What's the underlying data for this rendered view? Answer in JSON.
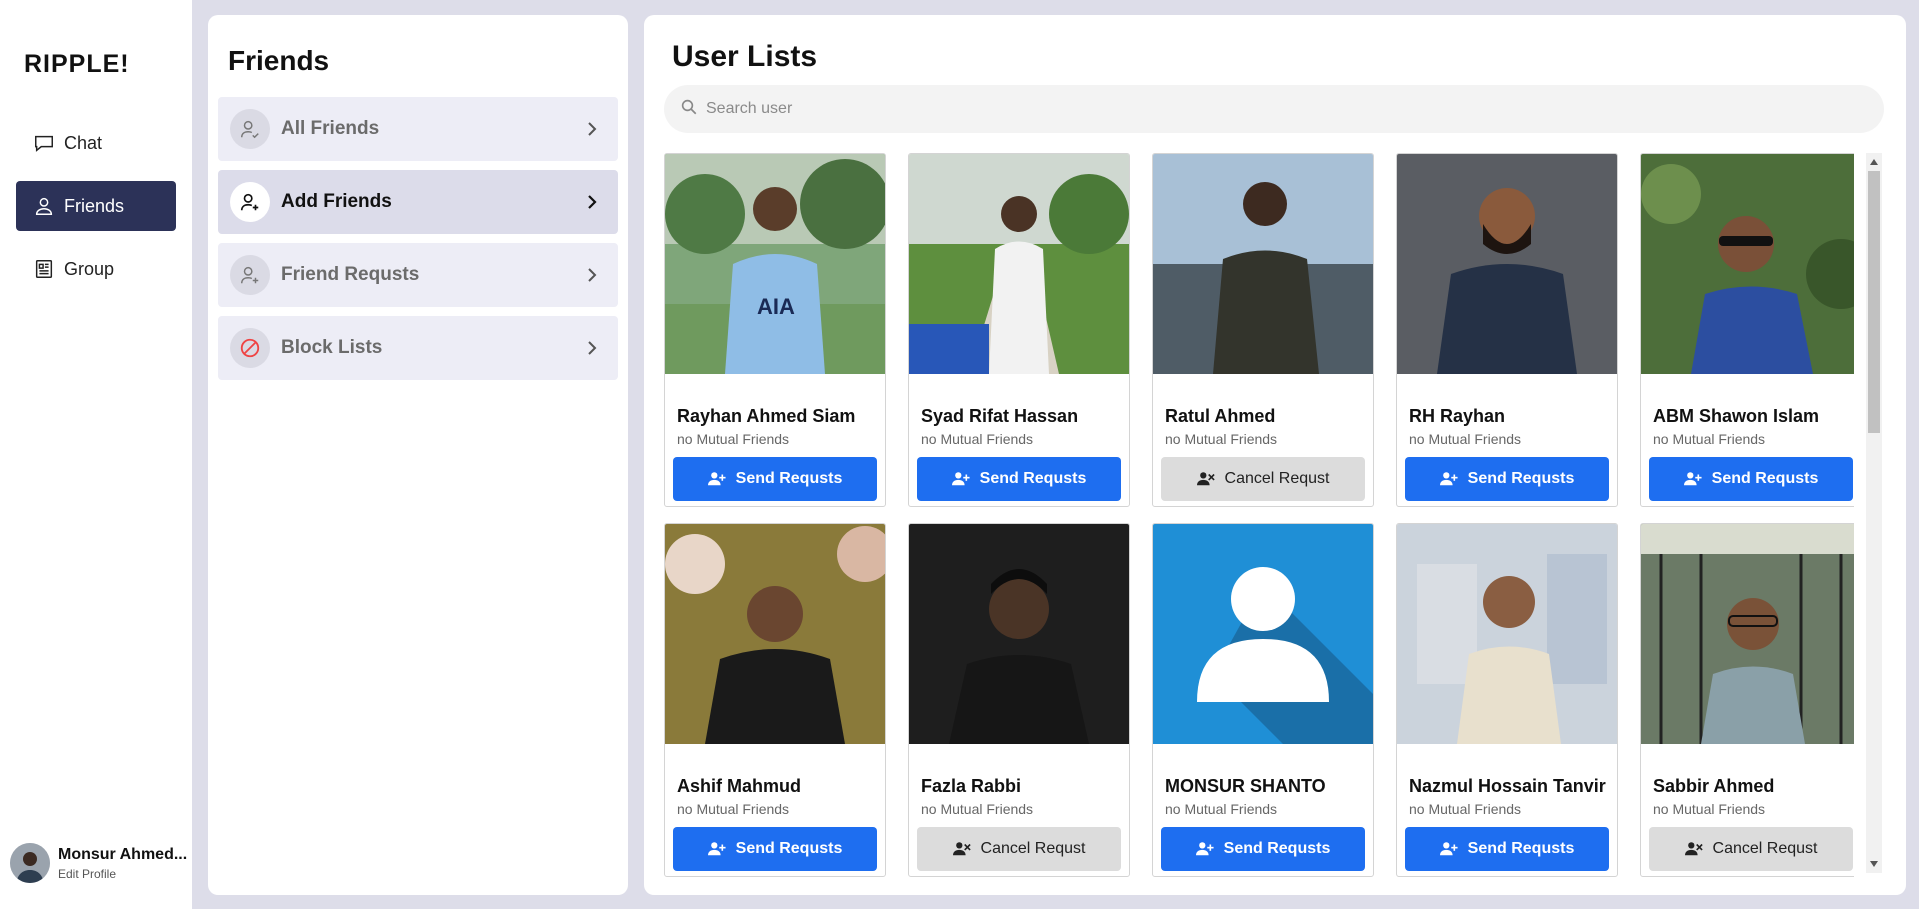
{
  "brand": "RIPPLE!",
  "nav": {
    "items": [
      {
        "label": "Chat",
        "icon": "chat-bubble-icon"
      },
      {
        "label": "Friends",
        "icon": "user-icon",
        "active": true
      },
      {
        "label": "Group",
        "icon": "newspaper-icon"
      }
    ]
  },
  "profile": {
    "name": "Monsur Ahmed...",
    "edit": "Edit Profile"
  },
  "friends_panel": {
    "title": "Friends",
    "items": [
      {
        "label": "All Friends",
        "icon": "user-check-icon"
      },
      {
        "label": "Add Friends",
        "icon": "user-plus-icon",
        "active": true
      },
      {
        "label": "Friend Requsts",
        "icon": "user-plus-icon"
      },
      {
        "label": "Block Lists",
        "icon": "ban-icon"
      }
    ]
  },
  "users_panel": {
    "title": "User Lists",
    "search_placeholder": "Search user",
    "users": [
      {
        "name": "Rayhan Ahmed Siam",
        "mutual": "no Mutual Friends",
        "button": "Send Requsts",
        "state": "send"
      },
      {
        "name": "Syad Rifat Hassan",
        "mutual": "no Mutual Friends",
        "button": "Send Requsts",
        "state": "send"
      },
      {
        "name": "Ratul Ahmed",
        "mutual": "no Mutual Friends",
        "button": "Cancel Requst",
        "state": "cancel"
      },
      {
        "name": "RH Rayhan",
        "mutual": "no Mutual Friends",
        "button": "Send Requsts",
        "state": "send"
      },
      {
        "name": "ABM Shawon Islam",
        "mutual": "no Mutual Friends",
        "button": "Send Requsts",
        "state": "send"
      },
      {
        "name": "Ashif Mahmud",
        "mutual": "no Mutual Friends",
        "button": "Send Requsts",
        "state": "send"
      },
      {
        "name": "Fazla Rabbi",
        "mutual": "no Mutual Friends",
        "button": "Cancel Requst",
        "state": "cancel"
      },
      {
        "name": "MONSUR SHANTO",
        "mutual": "no Mutual Friends",
        "button": "Send Requsts",
        "state": "send"
      },
      {
        "name": "Nazmul Hossain Tanvir",
        "mutual": "no Mutual Friends",
        "button": "Send Requsts",
        "state": "send"
      },
      {
        "name": "Sabbir Ahmed",
        "mutual": "no Mutual Friends",
        "button": "Cancel Requst",
        "state": "cancel"
      }
    ]
  },
  "colors": {
    "accent": "#1e6ef0",
    "nav_active": "#2c3258",
    "page_bg": "#dddde9"
  }
}
